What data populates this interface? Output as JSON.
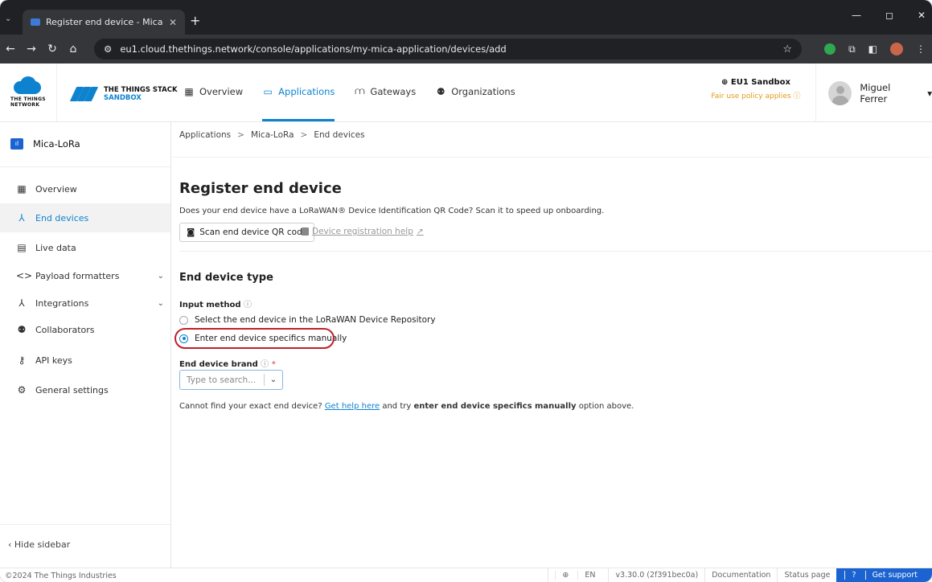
{
  "browser": {
    "tab_title": "Register end device - Mica-LoR",
    "tab_close": "✕",
    "new_tab": "+",
    "url": "eu1.cloud.thethings.network/console/applications/my-mica-application/devices/add",
    "window_controls": [
      "—",
      "◻",
      "✕"
    ]
  },
  "header": {
    "ttn_logo_text": "THE THINGS NETWORK",
    "stack_line1": "THE THINGS STACK",
    "stack_line2": "SANDBOX",
    "nav": [
      {
        "label": "Overview",
        "icon": "grid-icon"
      },
      {
        "label": "Applications",
        "icon": "window-icon",
        "active": true
      },
      {
        "label": "Gateways",
        "icon": "gateway-icon"
      },
      {
        "label": "Organizations",
        "icon": "people-icon"
      }
    ],
    "cluster_name": "EU1 Sandbox",
    "cluster_note": "Fair use policy applies",
    "user_name": "Miguel Ferrer"
  },
  "sidebar": {
    "app_name": "Mica-LoRa",
    "items": [
      {
        "label": "Overview",
        "icon": "grid-icon"
      },
      {
        "label": "End devices",
        "icon": "device-tree-icon",
        "active": true
      },
      {
        "label": "Live data",
        "icon": "list-icon"
      },
      {
        "label": "Payload formatters",
        "icon": "code-icon",
        "expandable": true
      },
      {
        "label": "Integrations",
        "icon": "integration-icon",
        "expandable": true
      },
      {
        "label": "Collaborators",
        "icon": "people-icon"
      },
      {
        "label": "API keys",
        "icon": "key-icon"
      },
      {
        "label": "General settings",
        "icon": "gear-icon"
      }
    ],
    "hide_label": "Hide sidebar"
  },
  "main": {
    "breadcrumbs": [
      "Applications",
      "Mica-LoRa",
      "End devices"
    ],
    "title": "Register end device",
    "qr_question": "Does your end device have a LoRaWAN® Device Identification QR Code? Scan it to speed up onboarding.",
    "scan_button": "Scan end device QR code",
    "help_link": "Device registration help",
    "section_title": "End device type",
    "input_method_label": "Input method",
    "radio_options": [
      {
        "label": "Select the end device in the LoRaWAN Device Repository",
        "checked": false
      },
      {
        "label": "Enter end device specifics manually",
        "checked": true
      }
    ],
    "brand_label": "End device brand",
    "brand_placeholder": "Type to search...",
    "cannot_find_prefix": "Cannot find your exact end device?",
    "cannot_find_link": "Get help here",
    "cannot_find_mid": "and try",
    "cannot_find_bold": "enter end device specifics manually",
    "cannot_find_suffix": "option above."
  },
  "footer": {
    "copyright": "©2024 The Things Industries",
    "language": "EN",
    "version": "v3.30.0 (2f391bec0a)",
    "documentation": "Documentation",
    "status_page": "Status page",
    "support": "Get support"
  },
  "colors": {
    "accent": "#0d83d0",
    "highlight_ring": "#c0202a",
    "support_bg": "#1b63d1"
  }
}
